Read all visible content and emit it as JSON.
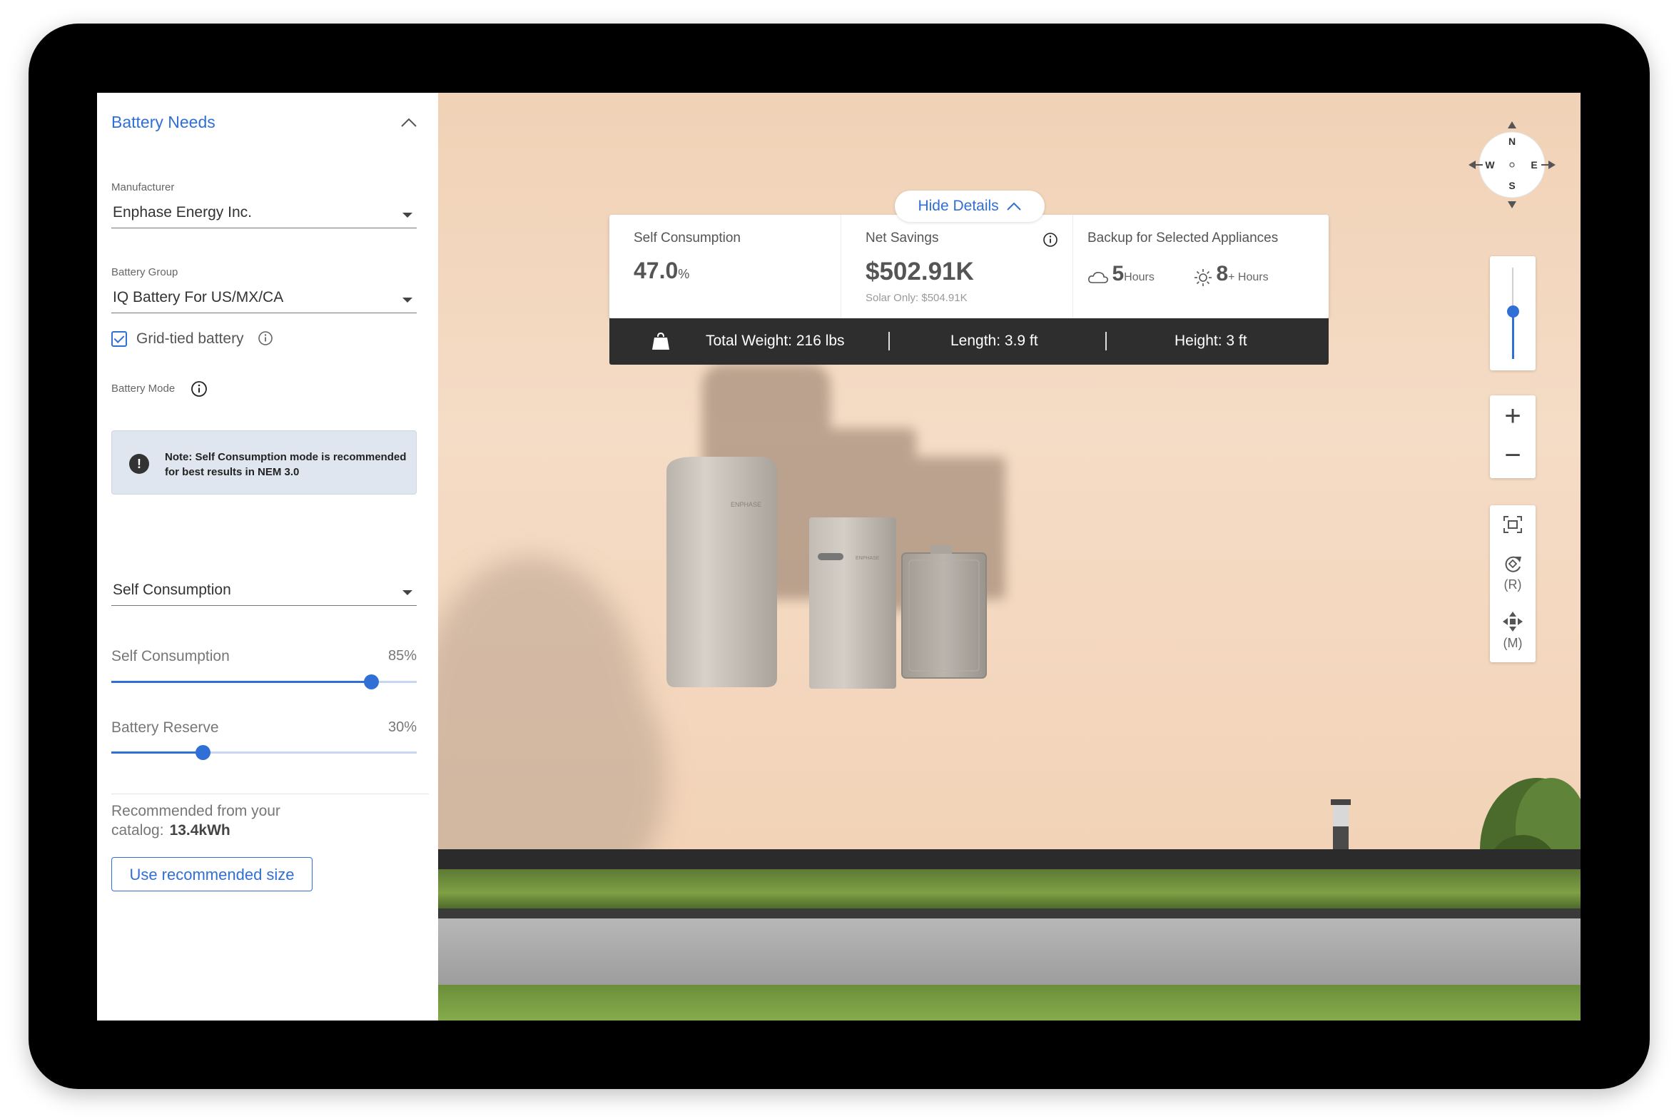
{
  "panel": {
    "title": "Battery Needs",
    "manufacturer_label": "Manufacturer",
    "manufacturer_value": "Enphase Energy Inc.",
    "group_label": "Battery Group",
    "group_value": "IQ Battery For US/MX/CA",
    "grid_tied_label": "Grid-tied battery",
    "grid_tied_checked": true,
    "mode_label": "Battery Mode",
    "note_text": "Note: Self Consumption mode is recommended for best results in NEM 3.0",
    "mode_value": "Self Consumption",
    "sliders": [
      {
        "label": "Self Consumption",
        "value_text": "85%",
        "value": 0.85
      },
      {
        "label": "Battery Reserve",
        "value_text": "30%",
        "value": 0.3
      }
    ],
    "recommended_prefix": "Recommended from your catalog:",
    "recommended_value": "13.4kWh",
    "use_recommended_label": "Use recommended size"
  },
  "details": {
    "hide_label": "Hide Details",
    "self_consumption": {
      "title": "Self Consumption",
      "value": "47.0",
      "unit": "%"
    },
    "net_savings": {
      "title": "Net Savings",
      "value": "$502.91K",
      "sub": "Solar Only: $504.91K"
    },
    "backup": {
      "title": "Backup for Selected Appliances",
      "cloudy_value": "5",
      "cloudy_unit": "Hours",
      "sunny_value": "8",
      "sunny_unit": "+ Hours"
    }
  },
  "specs": {
    "weight": "Total Weight: 216 lbs",
    "length": "Length: 3.9 ft",
    "height": "Height: 3 ft"
  },
  "controls": {
    "compass": {
      "n": "N",
      "s": "S",
      "e": "E",
      "w": "W"
    },
    "height_slider_value": 0.48,
    "zoom_in": "+",
    "zoom_out": "−",
    "rotate_caption": "(R)",
    "move_caption": "(M)"
  },
  "product": {
    "brand_label": "ENPHASE"
  },
  "colors": {
    "accent": "#2f6fd6",
    "wall": "#f3d9c1",
    "spec_bar": "#2e2e2e"
  }
}
